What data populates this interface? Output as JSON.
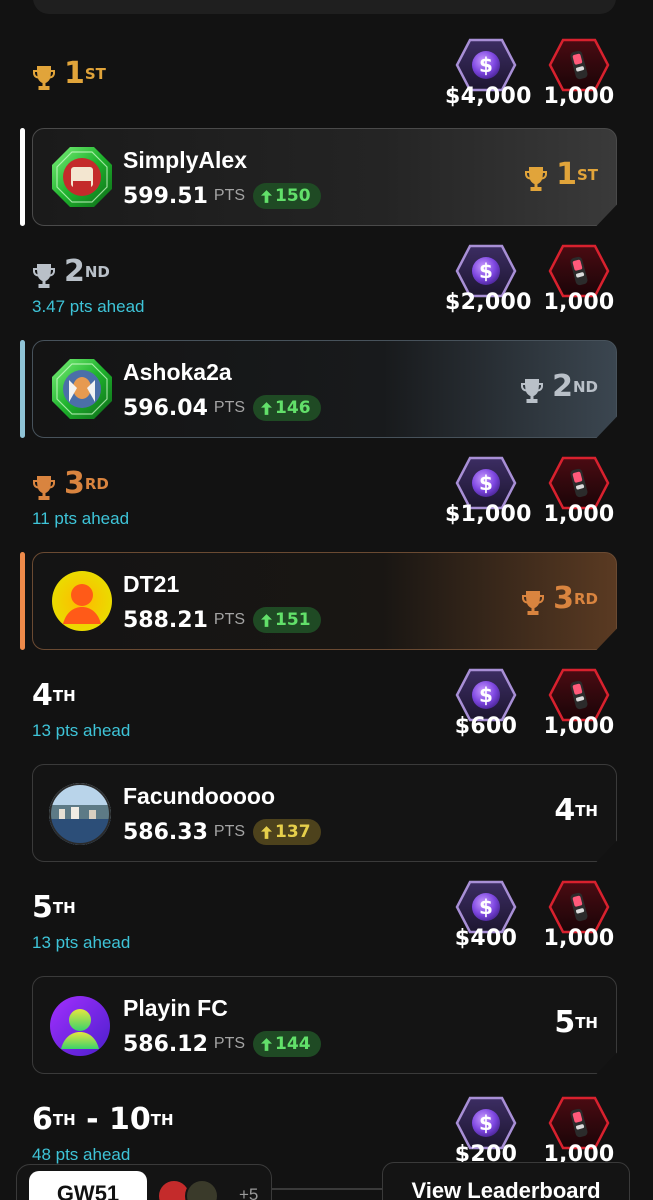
{
  "colors": {
    "gold": "#e1a43a",
    "silver": "#b9c0c8",
    "bronze": "#d9843f",
    "ahead": "#3ec4d8",
    "positive": "#62e06a",
    "amber": "#e6cf4b"
  },
  "prize_icons": {
    "cash": "dollar-coin-icon",
    "token": "red-token-icon"
  },
  "ranks": [
    {
      "num": "1",
      "suffix": "ST",
      "ahead": "",
      "cash": "$4,000",
      "token": "1,000"
    },
    {
      "num": "2",
      "suffix": "ND",
      "ahead": "3.47 pts ahead",
      "cash": "$2,000",
      "token": "1,000"
    },
    {
      "num": "3",
      "suffix": "RD",
      "ahead": "11 pts ahead",
      "cash": "$1,000",
      "token": "1,000"
    },
    {
      "num": "4",
      "suffix": "TH",
      "ahead": "13 pts ahead",
      "cash": "$600",
      "token": "1,000"
    },
    {
      "num": "5",
      "suffix": "TH",
      "ahead": "13 pts ahead",
      "cash": "$400",
      "token": "1,000"
    },
    {
      "num": "6",
      "suffix": "TH",
      "range_sep": " - ",
      "num2": "10",
      "suffix2": "TH",
      "ahead": "48 pts ahead",
      "cash": "$200",
      "token": "1,000"
    }
  ],
  "entries": [
    {
      "name": "SimplyAlex",
      "points": "599.51",
      "unit": "PTS",
      "change": "150",
      "rank": "1",
      "suffix": "ST"
    },
    {
      "name": "Ashoka2a",
      "points": "596.04",
      "unit": "PTS",
      "change": "146",
      "rank": "2",
      "suffix": "ND"
    },
    {
      "name": "DT21",
      "points": "588.21",
      "unit": "PTS",
      "change": "151",
      "rank": "3",
      "suffix": "RD"
    },
    {
      "name": "Facundooooo",
      "points": "586.33",
      "unit": "PTS",
      "change": "137",
      "rank": "4",
      "suffix": "TH"
    },
    {
      "name": "Playin FC",
      "points": "586.12",
      "unit": "PTS",
      "change": "144",
      "rank": "5",
      "suffix": "TH"
    }
  ],
  "footer": {
    "gameweek": "GW51",
    "more_count": "+5",
    "view_label": "View Leaderboard"
  }
}
